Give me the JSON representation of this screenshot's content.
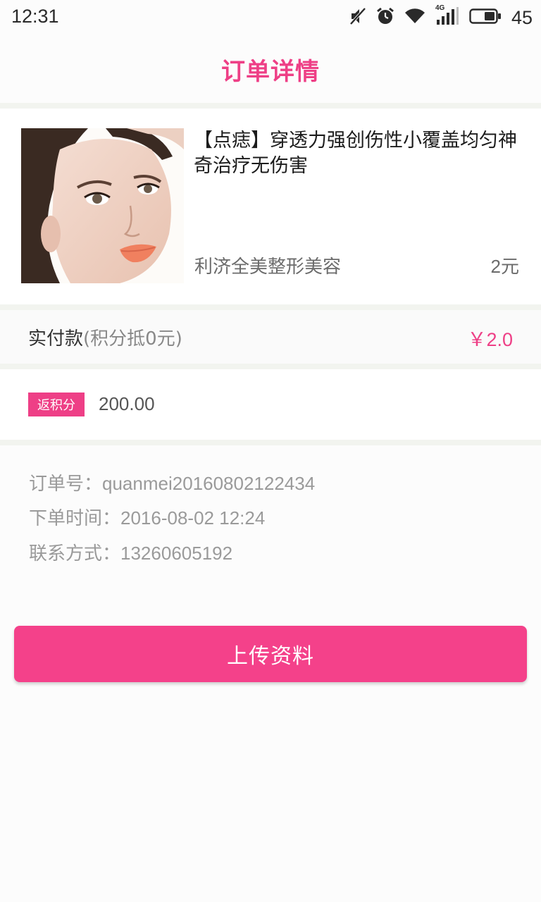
{
  "status_bar": {
    "time": "12:31",
    "network": "4G",
    "battery": "45",
    "icons": [
      "mute-icon",
      "alarm-icon",
      "wifi-icon",
      "signal-icon",
      "battery-icon"
    ]
  },
  "header": {
    "title": "订单详情"
  },
  "product": {
    "name": "【点痣】穿透力强创伤性小覆盖均匀神奇治疗无伤害",
    "shop": "利济全美整形美容",
    "price": "2元"
  },
  "payment": {
    "label": "实付款",
    "note": "(积分抵0元)",
    "amount": "￥2.0"
  },
  "points": {
    "badge": "返积分",
    "value": "200.00"
  },
  "order_info": {
    "order_no_label": "订单号：",
    "order_no": "quanmei20160802122434",
    "time_label": "下单时间：",
    "time": "2016-08-02 12:24",
    "contact_label": "联系方式：",
    "contact": "13260605192"
  },
  "actions": {
    "upload_label": "上传资料"
  },
  "colors": {
    "accent": "#ee3f86",
    "button": "#f4418a",
    "divider": "#f2f4ef"
  }
}
